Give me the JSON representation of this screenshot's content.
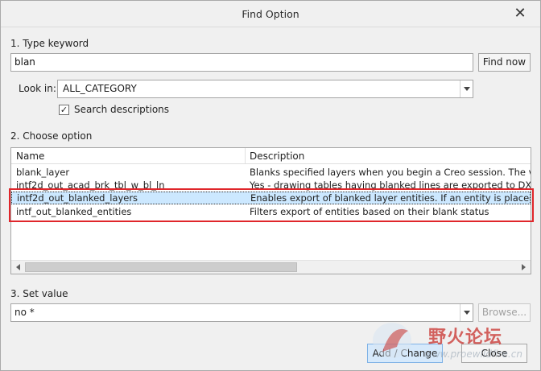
{
  "window": {
    "title": "Find Option"
  },
  "section1": {
    "label": "1.  Type keyword",
    "keyword_value": "blan",
    "find_now_label": "Find now"
  },
  "look_in": {
    "label": "Look in:",
    "value": "ALL_CATEGORY"
  },
  "search_descriptions": {
    "label": "Search descriptions",
    "checked": true,
    "check_glyph": "✓"
  },
  "section2": {
    "label": "2.  Choose option",
    "columns": {
      "name": "Name",
      "description": "Description"
    },
    "rows": [
      {
        "name": "blank_layer",
        "description": "Blanks specified layers when you begin a Creo session. The value is"
      },
      {
        "name": "intf2d_out_acad_brk_tbl_w_bl_ln",
        "description": "Yes - drawing tables having blanked lines are exported to DXF/DWG"
      },
      {
        "name": "intf2d_out_blanked_layers",
        "description": "Enables export of blanked layer entities. If an entity is placed on a la"
      },
      {
        "name": "intf_out_blanked_entities",
        "description": "Filters export of entities based on their blank status"
      }
    ],
    "selected_index": 2,
    "hscroll_position": 0.0
  },
  "section3": {
    "label": "3.  Set value",
    "value": "no *",
    "browse_label": "Browse..."
  },
  "footer": {
    "add_change_label": "Add / Change",
    "close_label": "Close"
  },
  "watermark": {
    "text": "野火论坛",
    "url": "www.proewildfire.cn"
  },
  "colors": {
    "selection": "#cce8ff",
    "highlight": "#e0262b"
  }
}
